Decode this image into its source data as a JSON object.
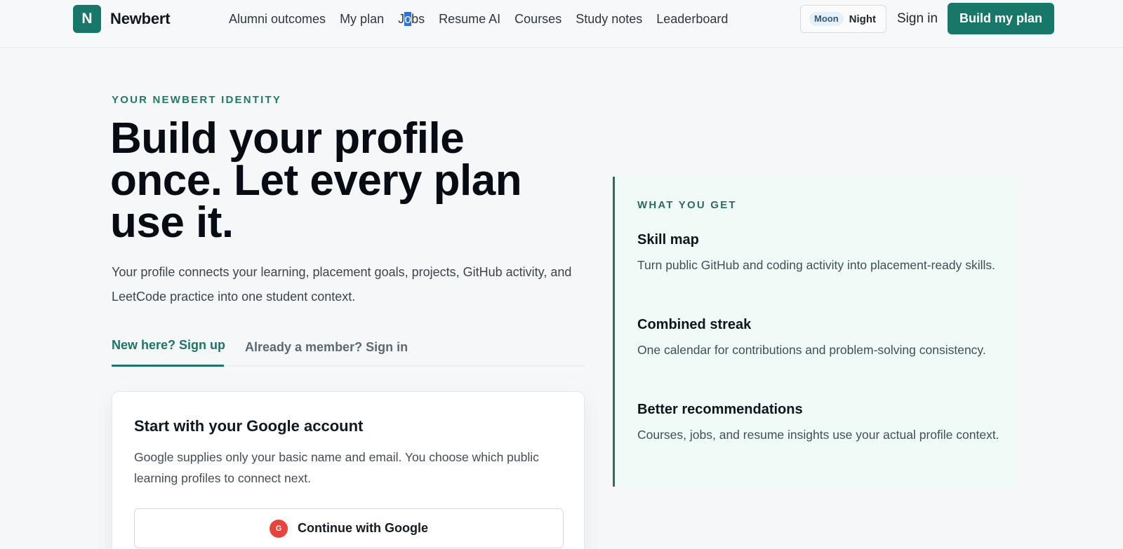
{
  "header": {
    "logo_letter": "N",
    "brand": "Newbert",
    "nav": [
      "Alumni outcomes",
      "My plan",
      "Jobs",
      "Resume AI",
      "Courses",
      "Study notes",
      "Leaderboard"
    ],
    "jobs_parts": [
      "J",
      "o",
      "bs"
    ],
    "theme_pill": "Moon",
    "theme_label": "Night",
    "sign_in": "Sign in",
    "cta": "Build my plan"
  },
  "hero": {
    "eyebrow": "YOUR NEWBERT IDENTITY",
    "title_lines": [
      "Build your profile",
      "once. Let every plan",
      "use it."
    ],
    "subtitle": "Your profile connects your learning, placement goals, projects, GitHub activity, and LeetCode practice into one student context."
  },
  "auth_tabs": {
    "active": "New here? Sign up",
    "inactive": "Already a member? Sign in"
  },
  "card": {
    "title": "Start with your Google account",
    "description": "Google supplies only your basic name and email. You choose which public learning profiles to connect next.",
    "google_icon_letter": "G",
    "google_button": "Continue with Google"
  },
  "benefits": {
    "eyebrow": "WHAT YOU GET",
    "items": [
      {
        "title": "Skill map",
        "description": "Turn public GitHub and coding activity into placement-ready skills."
      },
      {
        "title": "Combined streak",
        "description": "One calendar for contributions and problem-solving consistency."
      },
      {
        "title": "Better recommendations",
        "description": "Courses, jobs, and resume insights use your actual profile context."
      }
    ]
  },
  "colors": {
    "brand": "#17786a",
    "panel_bg": "#f0fbf8",
    "selection": "#2a73d9",
    "google_red": "#e8443b"
  },
  "icons": {
    "google": "google-icon",
    "logo": "logo-icon"
  }
}
